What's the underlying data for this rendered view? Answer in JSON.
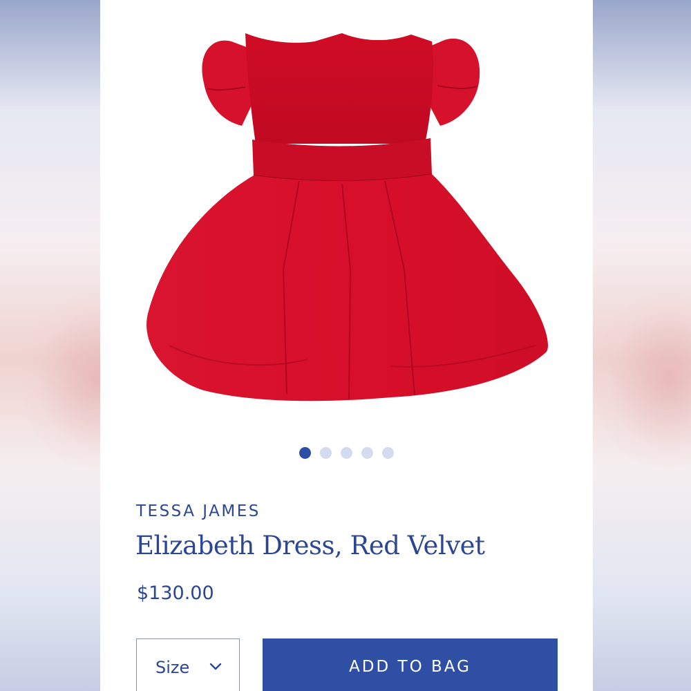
{
  "product": {
    "brand": "TESSA JAMES",
    "title": "Elizabeth Dress, Red Velvet",
    "price": "$130.00",
    "image_icon": "red-dress-image"
  },
  "carousel": {
    "total_slides": 5,
    "active_slide": 1
  },
  "actions": {
    "size_label": "Size",
    "add_to_bag_label": "ADD TO BAG"
  },
  "colors": {
    "accent": "#2f4fa4",
    "text": "#2b4693",
    "dot_inactive": "#d5dbee",
    "dress_red": "#d2102a"
  }
}
